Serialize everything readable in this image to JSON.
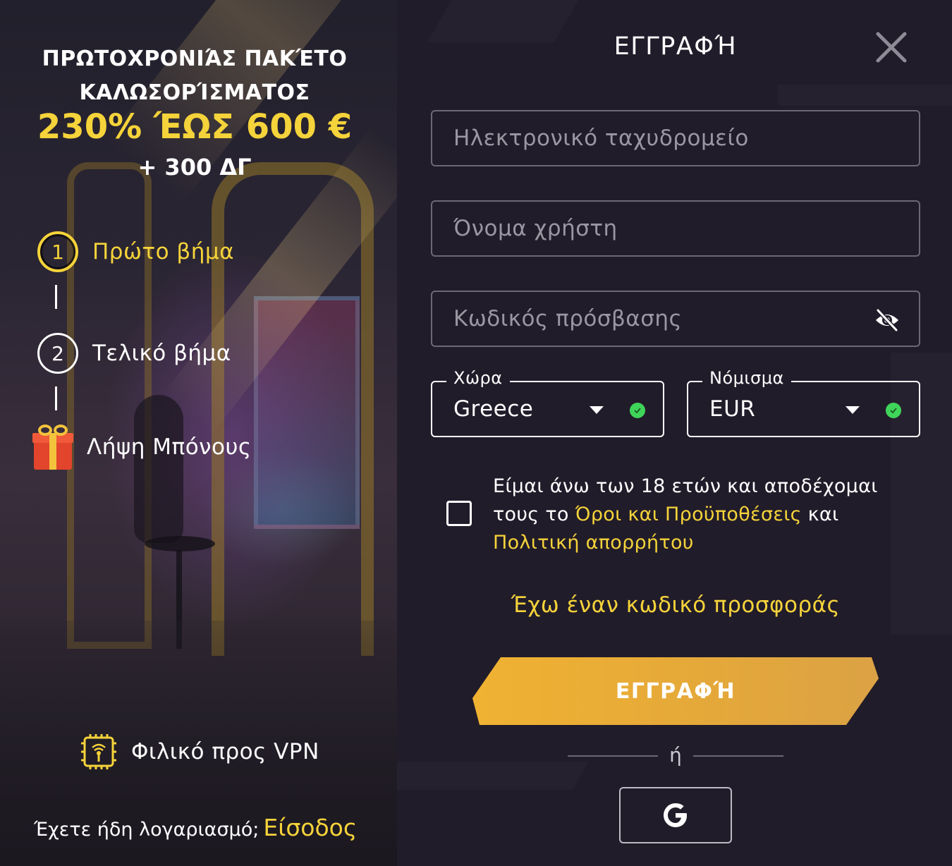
{
  "promo": {
    "title_line1": "ΠΡΩΤΟΧΡΟΝΙΆΣ ΠΑΚΈΤΟ",
    "title_line2": "ΚΑΛΩΣΟΡΊΣΜΑΤΟΣ",
    "amount": "230% ΈΩΣ 600 €",
    "extra": "+ 300 ΔΓ",
    "steps": [
      {
        "number": "1",
        "label": "Πρώτο βήμα",
        "active": true
      },
      {
        "number": "2",
        "label": "Τελικό βήμα",
        "active": false
      },
      {
        "number": "",
        "label": "Λήψη Μπόνους",
        "icon": "gift-icon"
      }
    ],
    "vpn_label": "Φιλικό προς VPN",
    "have_account_text": "Έχετε ήδη λογαριασμό;",
    "login_link": "Είσοδος"
  },
  "form": {
    "title": "ΕΓΓΡΑΦΉ",
    "email_placeholder": "Ηλεκτρονικό ταχυδρομείο",
    "username_placeholder": "Όνομα χρήστη",
    "password_placeholder": "Κωδικός πρόσβασης",
    "country": {
      "legend": "Χώρα",
      "value": "Greece"
    },
    "currency": {
      "legend": "Νόμισμα",
      "value": "EUR"
    },
    "terms": {
      "text_start": "Είμαι άνω των 18 ετών και αποδέχομαι τους το ",
      "terms_link": "Όροι και Προϋποθέσεις",
      "text_middle": " και ",
      "privacy_link": "Πολιτική απορρήτου",
      "checked": false
    },
    "promo_code_link": "Έχω έναν κωδικό προσφοράς",
    "register_button": "ΕΓΓΡΑΦΉ",
    "or_text": "ή",
    "google_button_icon": "google-icon"
  },
  "colors": {
    "accent": "#f5d33a",
    "button": "#f0b232",
    "background": "#211c2a",
    "valid": "#3fd45a"
  }
}
